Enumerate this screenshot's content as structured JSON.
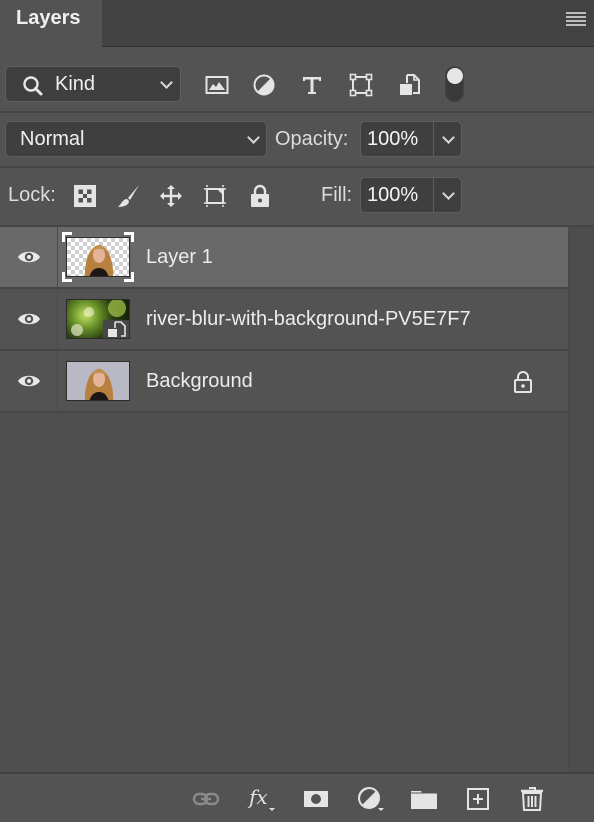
{
  "panel": {
    "tab_label": "Layers",
    "menu_icon": "panel-menu-icon"
  },
  "filter": {
    "kind_label": "Kind",
    "icons": [
      "pixel-layer-filter-icon",
      "adjustment-layer-filter-icon",
      "type-layer-filter-icon",
      "shape-layer-filter-icon",
      "smart-object-filter-icon"
    ],
    "toggle_state": "on"
  },
  "blend": {
    "mode": "Normal",
    "opacity_label": "Opacity:",
    "opacity_value": "100%"
  },
  "lock": {
    "label": "Lock:",
    "icons": [
      "lock-transparent-pixels-icon",
      "lock-image-pixels-icon",
      "lock-position-icon",
      "lock-artboard-icon",
      "lock-all-icon"
    ],
    "fill_label": "Fill:",
    "fill_value": "100%"
  },
  "layers": [
    {
      "name": "Layer 1",
      "visible": true,
      "selected": true,
      "locked": false,
      "thumb": "portrait-transparent"
    },
    {
      "name": "river-blur-with-background-PV5E7F7",
      "visible": true,
      "selected": false,
      "locked": false,
      "thumb": "smart-object-green-blur"
    },
    {
      "name": "Background",
      "visible": true,
      "selected": false,
      "locked": true,
      "thumb": "portrait-gray-bg"
    }
  ],
  "footer": {
    "buttons": [
      "link-layers-icon",
      "fx-icon",
      "add-mask-icon",
      "new-adjustment-layer-icon",
      "new-group-icon",
      "new-layer-icon",
      "delete-layer-icon"
    ]
  }
}
